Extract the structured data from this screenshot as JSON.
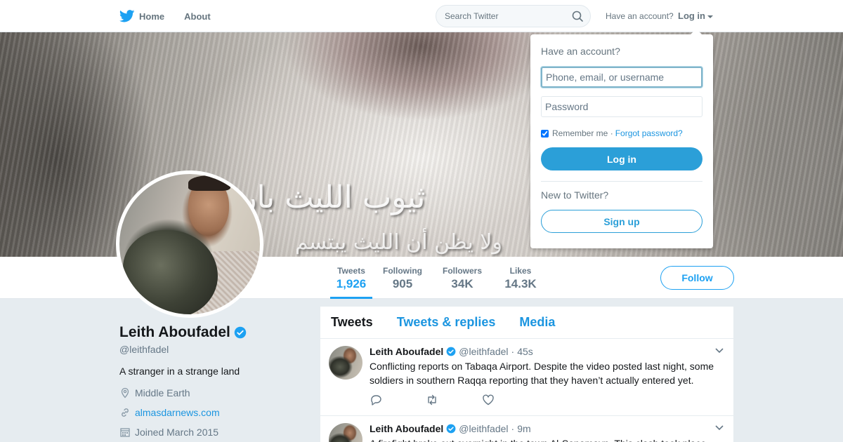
{
  "nav": {
    "home_label": "Home",
    "about_label": "About",
    "search_placeholder": "Search Twitter",
    "have_account": "Have an account?",
    "login_label": "Log in"
  },
  "banner": {
    "arabic_line1": "ثيوب الليث بارزة",
    "arabic_line2": "ولا يظن أن الليث يبتسم"
  },
  "stats": [
    {
      "label": "Tweets",
      "value": "1,926",
      "active": true
    },
    {
      "label": "Following",
      "value": "905"
    },
    {
      "label": "Followers",
      "value": "34K"
    },
    {
      "label": "Likes",
      "value": "14.3K"
    }
  ],
  "follow_label": "Follow",
  "profile": {
    "name": "Leith Aboufadel",
    "handle": "@leithfadel",
    "bio": "A stranger in a strange land",
    "location": "Middle Earth",
    "website": "almasdarnews.com",
    "joined": "Joined March 2015"
  },
  "timeline": {
    "tabs": [
      "Tweets",
      "Tweets & replies",
      "Media"
    ],
    "tweets": [
      {
        "name": "Leith Aboufadel",
        "handle": "@leithfadel",
        "time": "45s",
        "text": "Conflicting reports on Tabaqa Airport. Despite the video posted last night, some soldiers in southern Raqqa reporting that they haven’t actually entered yet."
      },
      {
        "name": "Leith Aboufadel",
        "handle": "@leithfadel",
        "time": "9m",
        "text": "A firefight broke out overnight in the town Al-Sanamayn. This clash took place"
      }
    ]
  },
  "login_dropdown": {
    "title": "Have an account?",
    "username_placeholder": "Phone, email, or username",
    "password_placeholder": "Password",
    "remember_label": "Remember me ·",
    "forgot_label": "Forgot password?",
    "login_button": "Log in",
    "new_label": "New to Twitter?",
    "signup_button": "Sign up"
  },
  "colors": {
    "accent": "#1da1f2",
    "link": "#1b95e0",
    "button": "#2b9fd8"
  }
}
